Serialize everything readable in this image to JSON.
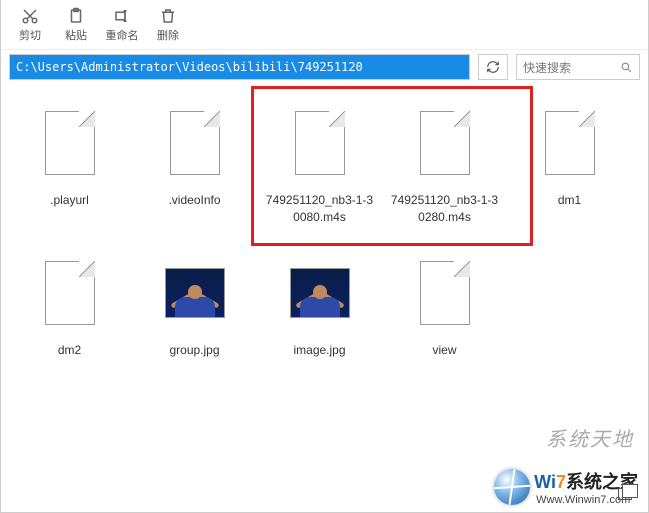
{
  "toolbar": {
    "cut": "剪切",
    "paste": "粘贴",
    "rename": "重命名",
    "delete": "删除"
  },
  "path": "C:\\Users\\Administrator\\Videos\\bilibili\\749251120",
  "search": {
    "placeholder": "快速搜索"
  },
  "files": [
    {
      "name": ".playurl",
      "type": "doc"
    },
    {
      "name": ".videoInfo",
      "type": "doc"
    },
    {
      "name": "749251120_nb3-1-30080.m4s",
      "type": "doc"
    },
    {
      "name": "749251120_nb3-1-30280.m4s",
      "type": "doc"
    },
    {
      "name": "dm1",
      "type": "doc"
    },
    {
      "name": "dm2",
      "type": "doc"
    },
    {
      "name": "group.jpg",
      "type": "photo"
    },
    {
      "name": "image.jpg",
      "type": "photo"
    },
    {
      "name": "view",
      "type": "doc"
    }
  ],
  "watermark": {
    "text1": "系统天地",
    "logo_w": "Wi",
    "logo_7": "7",
    "logo_tail": "系统之家",
    "url": "Www.Winwin7.com"
  }
}
